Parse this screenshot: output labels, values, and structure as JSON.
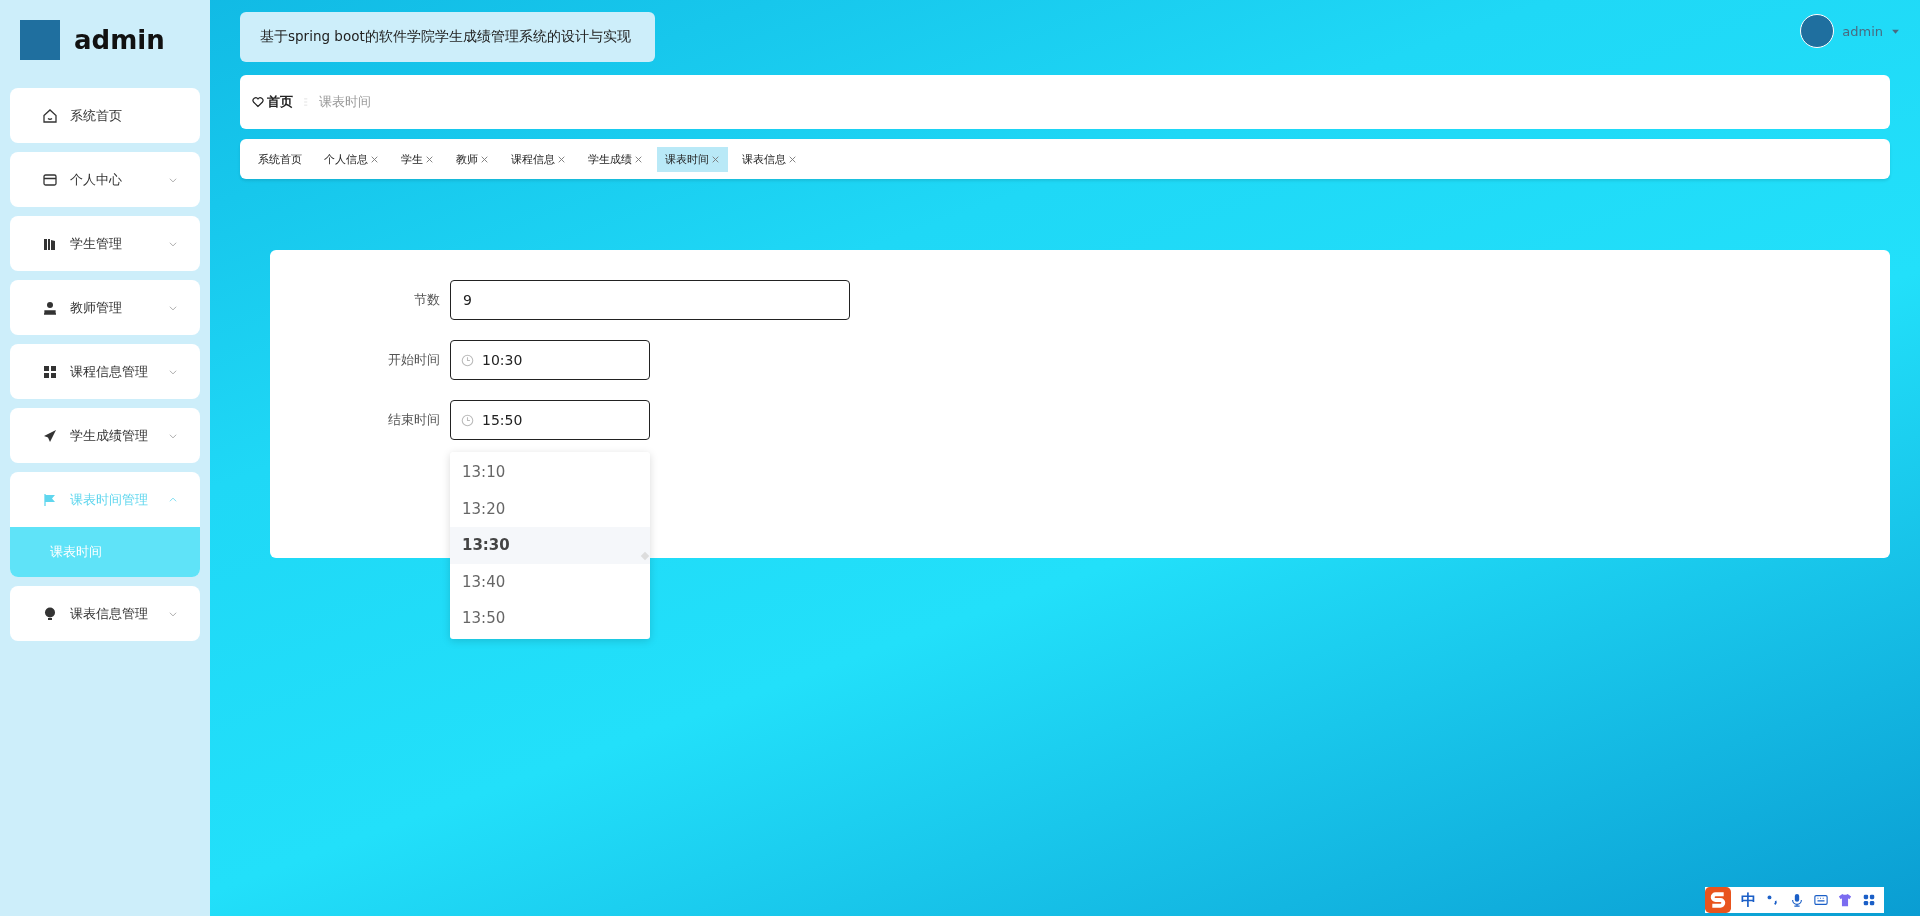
{
  "sidebar": {
    "user": {
      "name": "admin"
    },
    "items": [
      {
        "label": "系统首页",
        "expandable": false,
        "expanded": false
      },
      {
        "label": "个人中心",
        "expandable": true,
        "expanded": false
      },
      {
        "label": "学生管理",
        "expandable": true,
        "expanded": false
      },
      {
        "label": "教师管理",
        "expandable": true,
        "expanded": false
      },
      {
        "label": "课程信息管理",
        "expandable": true,
        "expanded": false
      },
      {
        "label": "学生成绩管理",
        "expandable": true,
        "expanded": false
      },
      {
        "label": "课表时间管理",
        "expandable": true,
        "expanded": true,
        "children": [
          {
            "label": "课表时间",
            "selected": true
          }
        ]
      },
      {
        "label": "课表信息管理",
        "expandable": true,
        "expanded": false
      }
    ]
  },
  "header": {
    "title": "基于spring boot的软件学院学生成绩管理系统的设计与实现",
    "user": {
      "name": "admin"
    }
  },
  "breadcrumb": {
    "home": "首页",
    "current": "课表时间"
  },
  "tabs": [
    {
      "label": "系统首页",
      "closable": false,
      "selected": false
    },
    {
      "label": "个人信息",
      "closable": true,
      "selected": false
    },
    {
      "label": "学生",
      "closable": true,
      "selected": false
    },
    {
      "label": "教师",
      "closable": true,
      "selected": false
    },
    {
      "label": "课程信息",
      "closable": true,
      "selected": false
    },
    {
      "label": "学生成绩",
      "closable": true,
      "selected": false
    },
    {
      "label": "课表时间",
      "closable": true,
      "selected": true
    },
    {
      "label": "课表信息",
      "closable": true,
      "selected": false
    }
  ],
  "form": {
    "fields": [
      {
        "label": "节数",
        "value": "9",
        "kind": "text"
      },
      {
        "label": "开始时间",
        "value": "10:30",
        "kind": "time"
      },
      {
        "label": "结束时间",
        "value": "15:50",
        "kind": "time"
      }
    ],
    "time_dropdown": {
      "options": [
        {
          "label": "13:10",
          "selected": false
        },
        {
          "label": "13:20",
          "selected": false
        },
        {
          "label": "13:30",
          "selected": true
        },
        {
          "label": "13:40",
          "selected": false
        },
        {
          "label": "13:50",
          "selected": false
        }
      ]
    }
  },
  "ime_toolbar": {
    "mode": "中"
  }
}
